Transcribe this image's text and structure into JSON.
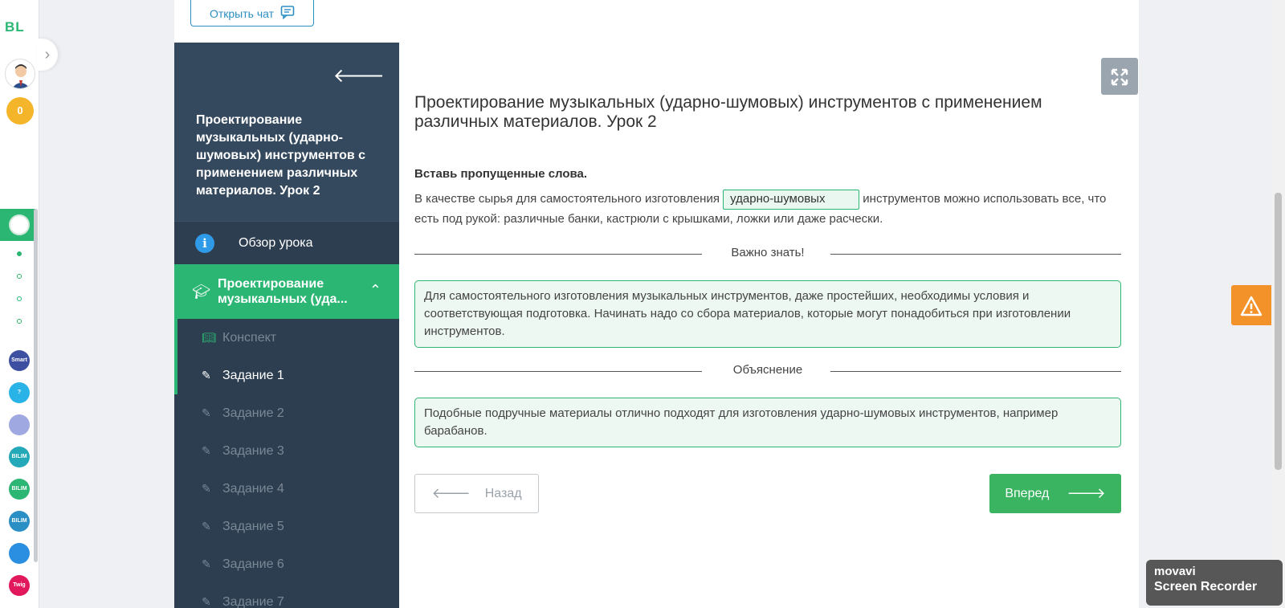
{
  "rail": {
    "logo": "BL",
    "score": "0",
    "apps": [
      {
        "name": "Smart Nation",
        "color": "#3c4fa0"
      },
      {
        "name": "?",
        "color": "#2ab3e6"
      },
      {
        "name": "",
        "color": "#9fa8e0"
      },
      {
        "name": "BILIM Center",
        "color": "#23a9b8"
      },
      {
        "name": "BILIM Land",
        "color": "#2bb673"
      },
      {
        "name": "BILIM Book",
        "color": "#2a8fc4"
      },
      {
        "name": "",
        "color": "#2a8fe0"
      },
      {
        "name": "Twig",
        "color": "#e2185c"
      }
    ]
  },
  "header": {
    "open_chat_label": "Открыть чат"
  },
  "sidebar": {
    "lesson_title": "Проектирование музыкальных (ударно-шумовых) инструментов с применением различных материалов. Урок 2",
    "overview_label": "Обзор урока",
    "section_label": "Проектирование музыкальных (уда...",
    "items": [
      {
        "label": "Конспект",
        "state": "done"
      },
      {
        "label": "Задание 1",
        "state": "current"
      },
      {
        "label": "Задание 2",
        "state": "todo"
      },
      {
        "label": "Задание 3",
        "state": "todo"
      },
      {
        "label": "Задание 4",
        "state": "todo"
      },
      {
        "label": "Задание 5",
        "state": "todo"
      },
      {
        "label": "Задание 6",
        "state": "todo"
      },
      {
        "label": "Задание 7",
        "state": "todo"
      }
    ]
  },
  "main": {
    "title": "Проектирование музыкальных (ударно-шумовых) инструментов с применением различных материалов. Урок 2",
    "instruction": "Вставь пропущенные слова.",
    "task_before": "В качестве сырья для самостоятельного изготовления ",
    "task_blank": "ударно-шумовых",
    "task_after": " инструментов можно использовать все, что есть под рукой: различные банки, кастрюли с крышками, ложки или даже расчески.",
    "important_heading": "Важно знать!",
    "important_text": "Для самостоятельного изготовления музыкальных инструментов, даже простейших, необходимы условия и соответствующая подготовка. Начинать надо со сбора материалов, которые могут понадобиться при изготовлении инструментов.",
    "explanation_heading": "Объяснение",
    "explanation_text": "Подобные подручные материалы отлично подходят для изготовления ударно-шумовых инструментов, например барабанов.",
    "back_label": "Назад",
    "next_label": "Вперед"
  },
  "watermark": {
    "line1": "movavi",
    "line2": "Screen Recorder"
  }
}
